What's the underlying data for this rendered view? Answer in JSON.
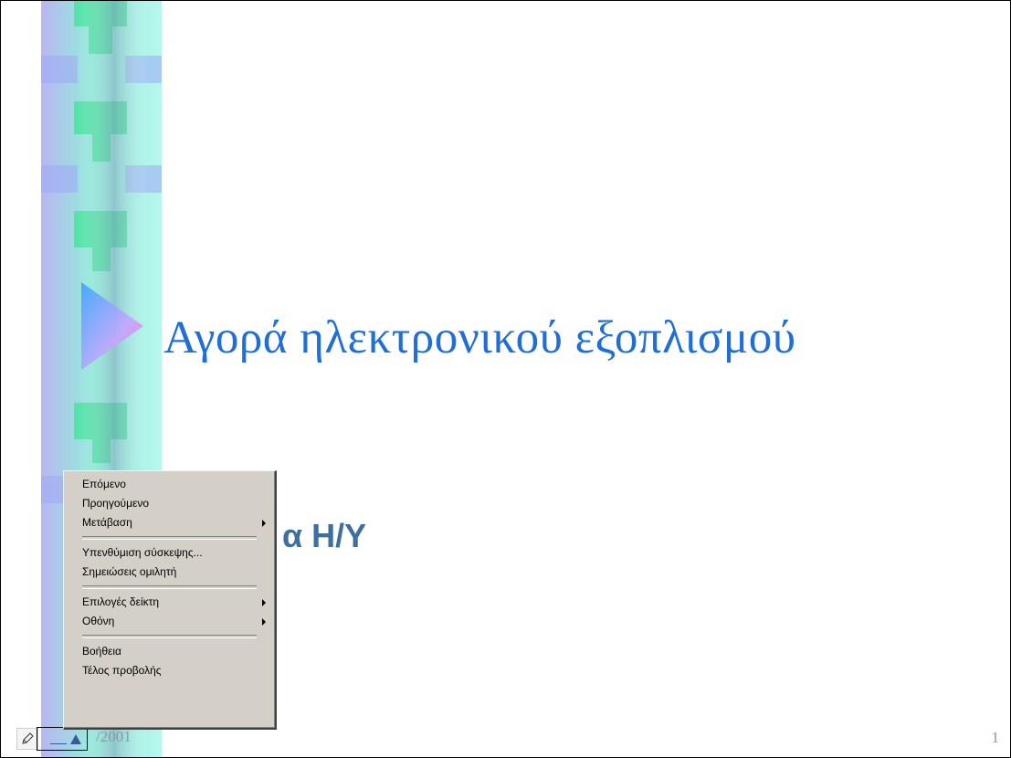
{
  "slide": {
    "title": "Αγορά ηλεκτρονικού εξοπλισμού",
    "subtitle_visible": "α Η/Υ",
    "footer_date_visible": "/2001",
    "slide_number": "1"
  },
  "colors": {
    "title": "#1f6fd6",
    "subtitle": "#3f6f9f",
    "footer": "#8a9a9f",
    "menu_bg": "#d4d0c8"
  },
  "nav_control": {
    "pen_icon": "pen-icon",
    "menu_button_icon": "slideshow-menu-icon"
  },
  "context_menu": {
    "items": [
      {
        "label": "Επόμενο",
        "submenu": false
      },
      {
        "label": "Προηγούμενο",
        "submenu": false
      },
      {
        "label": "Μετάβαση",
        "submenu": true
      },
      {
        "label": "Υπενθύμιση σύσκεψης...",
        "submenu": false
      },
      {
        "label": "Σημειώσεις ομιλητή",
        "submenu": false
      },
      {
        "label": "Επιλογές δείκτη",
        "submenu": true
      },
      {
        "label": "Οθόνη",
        "submenu": true
      },
      {
        "label": "Βοήθεια",
        "submenu": false
      },
      {
        "label": "Τέλος προβολής",
        "submenu": false
      }
    ]
  }
}
